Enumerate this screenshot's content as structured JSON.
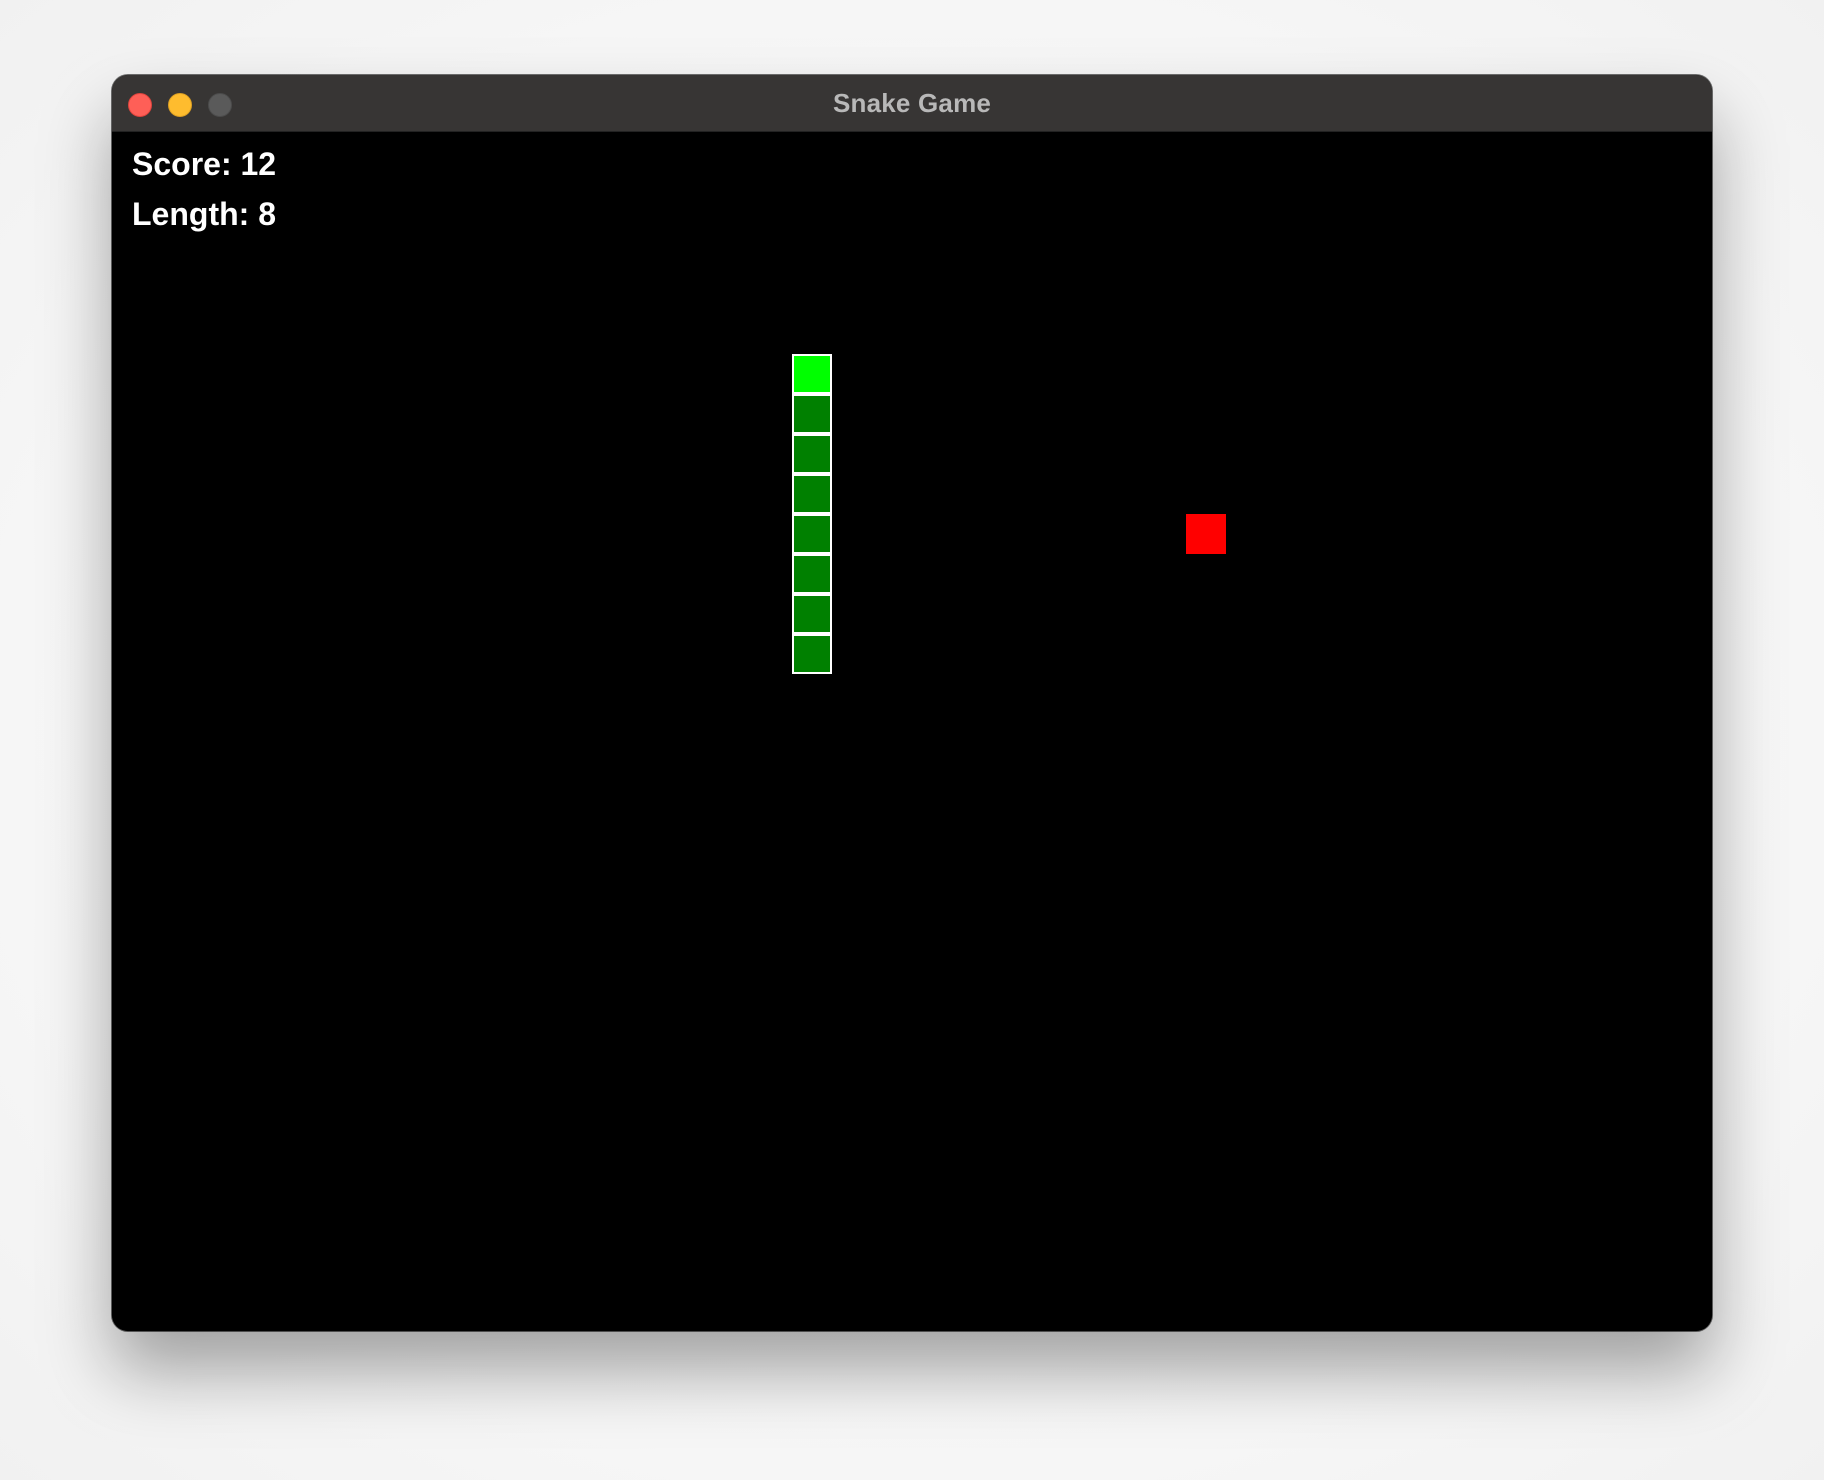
{
  "window": {
    "title": "Snake Game",
    "buttons": [
      "close",
      "minimize",
      "zoom"
    ]
  },
  "hud": {
    "score_text": "Score: 12",
    "length_text": "Length: 8"
  },
  "game": {
    "score": 12,
    "length": 8,
    "grid_cell_units": 1,
    "snake_head_color": "#00ff00",
    "snake_body_color": "#008000",
    "snake_outline_color": "#ffffff",
    "food_color": "#ff0000",
    "background_color": "#000000",
    "snake_cells": [
      {
        "col": 17,
        "row": 3,
        "part": "head"
      },
      {
        "col": 17,
        "row": 4,
        "part": "body"
      },
      {
        "col": 17,
        "row": 5,
        "part": "body"
      },
      {
        "col": 17,
        "row": 6,
        "part": "body"
      },
      {
        "col": 17,
        "row": 7,
        "part": "body"
      },
      {
        "col": 17,
        "row": 8,
        "part": "body"
      },
      {
        "col": 17,
        "row": 9,
        "part": "body"
      },
      {
        "col": 17,
        "row": 10,
        "part": "body"
      }
    ],
    "food_cell": {
      "col": 27,
      "row": 7
    }
  }
}
